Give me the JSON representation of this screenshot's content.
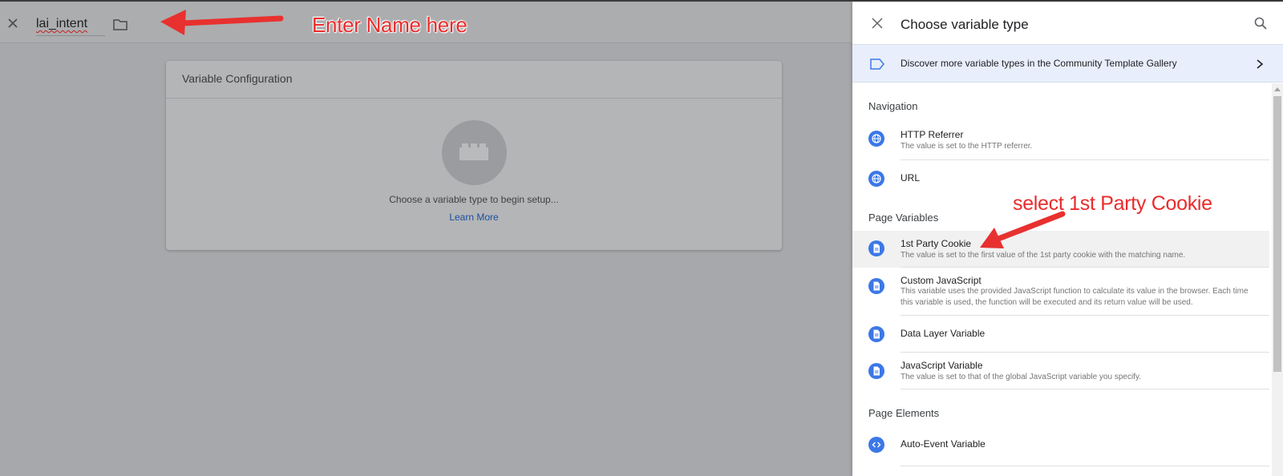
{
  "editor": {
    "variable_name": "lai_intent",
    "card_title": "Variable Configuration",
    "card_hint": "Choose a variable type to begin setup...",
    "learn_more": "Learn More"
  },
  "annotations": {
    "name_note": "Enter Name here",
    "cookie_note": "select 1st Party Cookie",
    "color": "#ea2b2b"
  },
  "panel": {
    "title": "Choose variable type",
    "gallery_text": "Discover more variable types in the Community Template Gallery",
    "sections": [
      {
        "label": "Navigation",
        "items": [
          {
            "title": "HTTP Referrer",
            "desc": "The value is set to the HTTP referrer.",
            "icon": "globe-icon"
          },
          {
            "title": "URL",
            "desc": "",
            "icon": "globe-icon"
          }
        ]
      },
      {
        "label": "Page Variables",
        "items": [
          {
            "title": "1st Party Cookie",
            "desc": "The value is set to the first value of the 1st party cookie with the matching name.",
            "icon": "document-icon"
          },
          {
            "title": "Custom JavaScript",
            "desc": "This variable uses the provided JavaScript function to calculate its value in the browser. Each time this variable is used, the function will be executed and its return value will be used.",
            "icon": "document-icon"
          },
          {
            "title": "Data Layer Variable",
            "desc": "",
            "icon": "document-icon"
          },
          {
            "title": "JavaScript Variable",
            "desc": "The value is set to that of the global JavaScript variable you specify.",
            "icon": "document-icon"
          }
        ]
      },
      {
        "label": "Page Elements",
        "items": [
          {
            "title": "Auto-Event Variable",
            "desc": "",
            "icon": "code-icon"
          }
        ]
      }
    ]
  },
  "colors": {
    "accent": "#3b78e7",
    "banner_bg": "#e8eefb",
    "overlay": "#a7a8ab"
  }
}
